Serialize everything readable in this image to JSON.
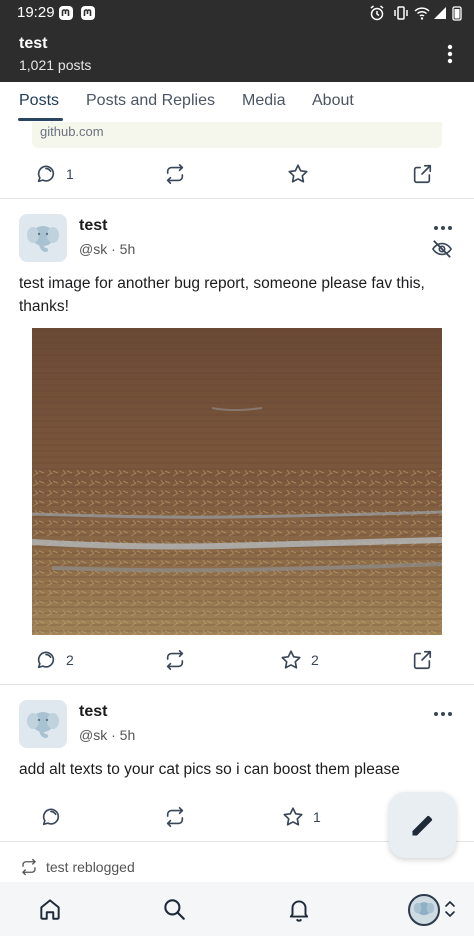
{
  "status_bar": {
    "time": "19:29"
  },
  "header": {
    "title": "test",
    "post_count": "1,021 posts",
    "menu_icon": "more-vertical-icon"
  },
  "tabs": [
    {
      "label": "Posts",
      "active": true
    },
    {
      "label": "Posts and Replies",
      "active": false
    },
    {
      "label": "Media",
      "active": false
    },
    {
      "label": "About",
      "active": false
    }
  ],
  "previous_post": {
    "link_domain": "github.com",
    "actions": {
      "replies": "1",
      "boosts": "",
      "favourites": ""
    }
  },
  "posts": [
    {
      "author": "test",
      "handle": "@sk",
      "time": "5h",
      "meta": "@sk · 5h",
      "content": "test image for another bug report, someone please fav this, thanks!",
      "has_image": true,
      "actions": {
        "replies": "2",
        "boosts": "",
        "favourites": "2"
      }
    },
    {
      "author": "test",
      "handle": "@sk",
      "time": "5h",
      "meta": "@sk · 5h",
      "content": "add alt texts to your cat pics so i can boost them please",
      "has_image": false,
      "actions": {
        "replies": "",
        "boosts": "",
        "favourites": "1"
      }
    }
  ],
  "reblog_notice": "test reblogged",
  "colors": {
    "app_bar": "#2d2d2d",
    "accent": "#2a4562",
    "icon": "#3a4758"
  }
}
